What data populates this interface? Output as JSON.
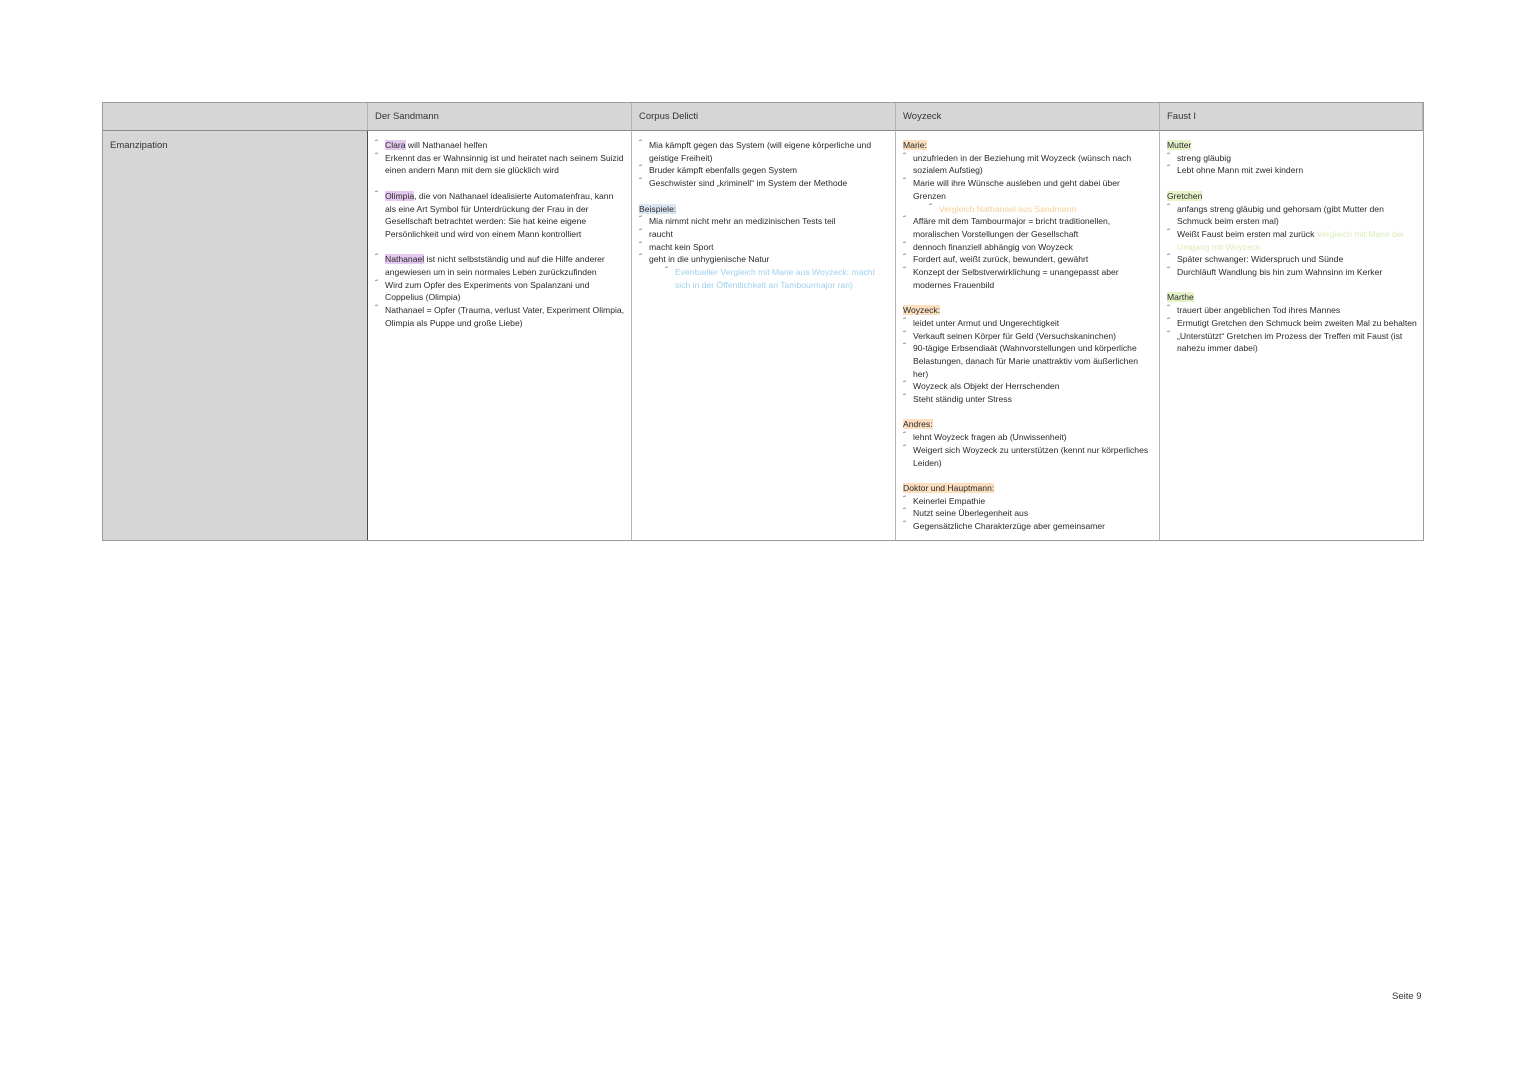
{
  "table": {
    "headers": [
      "",
      "Der Sandmann",
      "Corpus Delicti",
      "Woyzeck",
      "Faust I"
    ],
    "row_label": "Emanzipation",
    "sandmann": {
      "clara_name": "Clara",
      "clara_rest": " will Nathanael helfen",
      "item2": "Erkennt das er Wahnsinnig ist und heiratet nach seinem Suizid einen andern Mann mit dem sie glücklich wird",
      "olimpia_name": "Olimpia",
      "olimpia_rest": ", die von Nathanael idealisierte Automatenfrau, kann als eine Art Symbol für Unterdrückung der Frau in der Gesellschaft betrachtet werden: Sie hat keine eigene Persönlichkeit und wird von einem Mann kontrolliert",
      "nathanael_name": "Nathanael",
      "nathanael_rest": " ist nicht selbstständig und auf die Hilfe anderer angewiesen um in sein normales Leben zurückzufinden",
      "item5": "Wird zum Opfer des Experiments von Spalanzani und Coppelius (Olimpia)",
      "item6": "Nathanael = Opfer (Trauma, verlust Vater, Experiment Olimpia, Olimpia als Puppe und große Liebe)"
    },
    "corpus": {
      "items": [
        "Mia kämpft gegen das System (will eigene körperliche und geistige Freiheit)",
        "Bruder kämpft ebenfalls gegen System",
        "Geschwister sind „kriminell“ im System der Methode"
      ],
      "beispiele_label": "Beispiele:",
      "beispiele": [
        "Mia nimmt nicht mehr an medizinischen Tests teil",
        "raucht",
        "macht kein Sport",
        "geht in die unhygienische Natur"
      ],
      "vergleich": "Eventueller Vergleich mit Marie aus Woyzeck: macht sich in der Öffentlichkeit an Tambourmajor ran)"
    },
    "woyzeck": {
      "marie_label": "Marie:",
      "marie_a": [
        "unzufrieden in der Beziehung mit Woyzeck (wünsch nach sozialem Aufstieg)",
        "Marie will ihre Wünsche ausleben und geht dabei über Grenzen"
      ],
      "marie_vergleich": "Vergleich Nathanael aus Sandmann",
      "marie_b": [
        "Affäre mit dem Tambourmajor = bricht traditionellen, moralischen Vorstellungen der Gesellschaft",
        "dennoch finanziell abhängig von Woyzeck",
        "Fordert auf, weißt zurück, bewundert, gewährt",
        "Konzept der Selbstverwirklichung = unangepasst aber modernes Frauenbild"
      ],
      "woyzeck_label": "Woyzeck:",
      "woyzeck_items": [
        "leidet unter Armut und Ungerechtigkeit",
        "Verkauft seinen Körper für Geld (Versuchskaninchen)",
        "90-tägige Erbsendiaät (Wahnvorstellungen und körperliche Belastungen, danach für Marie unattraktiv vom äußerlichen her)",
        "Woyzeck als Objekt der Herrschenden",
        "Steht ständig unter Stress"
      ],
      "andres_label": "Andres:",
      "andres_items": [
        "lehnt Woyzeck fragen ab (Unwissenheit)",
        "Weigert sich Woyzeck zu unterstützen (kennt nur körperliches Leiden)"
      ],
      "doktor_label": "Doktor und Hauptmann:",
      "doktor_items": [
        "Keinerlei Empathie",
        "Nutzt seine Überlegenheit aus",
        "Gegensätzliche Charakterzüge aber gemeinsamer"
      ]
    },
    "faust": {
      "mutter_label": "Mutter",
      "mutter_items": [
        "streng gläubig",
        "Lebt ohne Mann mit zwei kindern"
      ],
      "gretchen_label": "Gretchen",
      "gretchen_item1": "anfangs streng gläubig und gehorsam (gibt Mutter den Schmuck beim ersten mal)",
      "gretchen_item2": "Weißt Faust beim ersten mal zurück ",
      "gretchen_item2_faint": "Vergleich mit Marie bei Umgang mit Woyzeck",
      "gretchen_items_rest": [
        "Später schwanger: Widerspruch und Sünde",
        "Durchläuft Wandlung bis hin zum Wahnsinn im Kerker"
      ],
      "marthe_label": "Marthe",
      "marthe_items": [
        "trauert über angeblichen Tod ihres Mannes",
        "Ermutigt Gretchen den Schmuck beim zweiten Mal zu behalten",
        "„Unterstützt“ Gretchen im Prozess der Treffen mit Faust (ist nahezu immer dabei)"
      ]
    }
  },
  "page_number": "Seite 9",
  "colors": {
    "header_bg": "#d6d6d6",
    "highlight_purple": "#e3c8ef",
    "highlight_blue": "#dbe7f3",
    "highlight_orange": "#fbdfbf",
    "highlight_green": "#e6f2c8"
  }
}
